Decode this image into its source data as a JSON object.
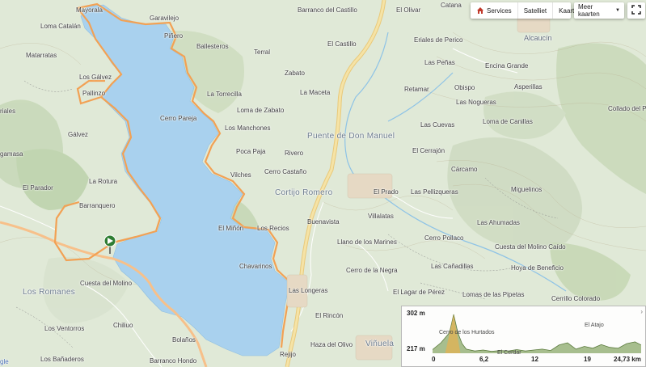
{
  "controls": {
    "services_label": "Services",
    "satellite_label": "Satelliet",
    "map_label": "Kaart",
    "more_maps_label": "Meer kaarten"
  },
  "colors": {
    "water": "#a9d1ee",
    "route": "#f2a154",
    "main_road": "#f5e3a6",
    "marker": "#2e7d32"
  },
  "labels": {
    "mayorala": "Mayorala",
    "garavilejo": "Garavilejo",
    "loma_catalan": "Loma Catalán",
    "matarratas": "Matarratas",
    "los_galvez": "Los Gálvez",
    "pallinzo": "Pallinzo",
    "pinero": "Piñero",
    "ballesteros": "Ballesteros",
    "terral": "Terral",
    "zabato": "Zabato",
    "barranco_castillo": "Barranco del Castillo",
    "el_castillo": "El Castillo",
    "el_olivar": "El Olivar",
    "catana": "Catana",
    "erales_perico": "Eriales de Perico",
    "alcaucin": "Alcaucín",
    "las_penas": "Las Peñas",
    "encina_grande": "Encina Grande",
    "retamar": "Retamar",
    "obispo": "Obispo",
    "asperillas": "Asperillas",
    "las_nogueras": "Las Nogueras",
    "collado": "Collado del P",
    "la_maceta": "La Maceta",
    "la_torrecilla": "La Torrecilla",
    "loma_zabato": "Loma de Zabato",
    "cerro_pareja": "Cerro Pareja",
    "los_manchones": "Los Manchones",
    "puente_don_manuel": "Puente de Don Manuel",
    "las_cuevas": "Las Cuevas",
    "loma_canillas": "Loma de Canillas",
    "el_cerrajon": "El Cerrajón",
    "poca_paja": "Poca Paja",
    "rivero": "Rivero",
    "galvez": "Gálvez",
    "riales": "riales",
    "gamasa": "gamasa",
    "cerro_castano": "Cerro Castaño",
    "vilches": "Vilches",
    "carcamo": "Cárcamo",
    "miguelinos": "Miguelinos",
    "el_parador": "El Parador",
    "la_rotura": "La Rotura",
    "cortijo_romero": "Cortijo Romero",
    "el_prado": "El Prado",
    "las_pellizqueras": "Las Pellizqueras",
    "barranquero": "Barranquero",
    "villalatas": "Villalatas",
    "buenavista": "Buenavista",
    "las_ahumadas": "Las Ahumadas",
    "el_minon": "El Miñón",
    "los_recios": "Los Recios",
    "cerro_pollaco": "Cerro Pollaco",
    "llano_marines": "Llano de los Marines",
    "cuesta_molino_caido": "Cuesta del Molino Caído",
    "los_romanes": "Los Romanes",
    "chavarinos": "Chavarinos",
    "hoya_beneficio": "Hoya de Beneficio",
    "cerro_negra": "Cerro de la Negra",
    "las_canadillas": "Las Cañadillas",
    "cuesta_molino": "Cuesta del Molino",
    "las_longeras": "Las Longeras",
    "el_lagar_perez": "El Lagar de Pérez",
    "lomas_pipetas": "Lomas de las Pipetas",
    "cerrillo_colorado": "Cerrillo Colorado",
    "los_ventorros": "Los Ventorros",
    "chiliuo": "Chiliuo",
    "el_rincon": "El Rincón",
    "bolanos": "Bolaños",
    "haza_olivo": "Haza del Olivo",
    "vinuela": "Viñuela",
    "los_banaderos": "Los Bañaderos",
    "barranco_hondo": "Barranco Hondo",
    "rejijo": "Rejijo",
    "gle": "gle"
  },
  "elevation": {
    "max_label": "302 m",
    "min_label": "217 m",
    "ticks": [
      "0",
      "6,2",
      "12",
      "19",
      "24,73 km"
    ],
    "inner_labels": [
      "Cerro de los Hurtados",
      "El Atajo",
      "El Cerdar"
    ],
    "profile_km": [
      0,
      1,
      2,
      2.5,
      3,
      3.5,
      4,
      5,
      6,
      7,
      8,
      9,
      10,
      11,
      12,
      13,
      14,
      15,
      16,
      17,
      18,
      19,
      20,
      21,
      22,
      23,
      24,
      24.73
    ],
    "profile_m": [
      225,
      240,
      262,
      302,
      262,
      238,
      226,
      222,
      224,
      221,
      223,
      222,
      225,
      222,
      224,
      226,
      223,
      235,
      240,
      226,
      232,
      228,
      236,
      230,
      228,
      238,
      242,
      235
    ]
  }
}
